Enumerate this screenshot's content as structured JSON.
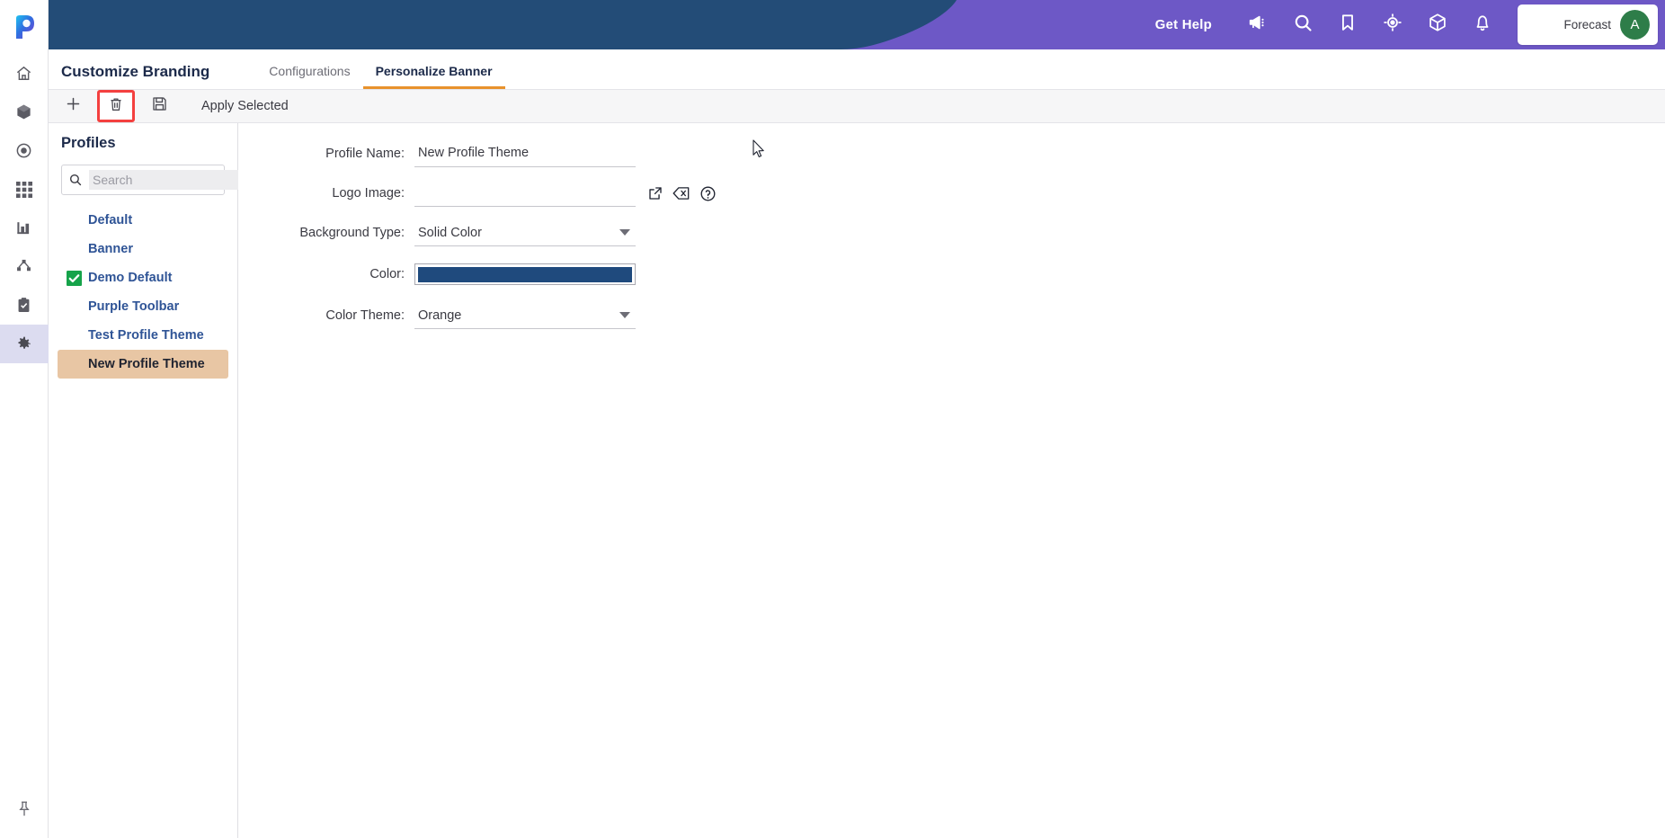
{
  "app": {
    "logo_icon": "pegasystems-p-logo",
    "navy": "#234C77",
    "purple": "#6D58C6",
    "accent_orange": "#E8922C",
    "highlight_red": "#F4403F"
  },
  "rail": {
    "items": [
      {
        "name": "home",
        "icon": "home-icon",
        "active": false
      },
      {
        "name": "packages",
        "icon": "box-icon",
        "active": false
      },
      {
        "name": "targets",
        "icon": "target-icon",
        "active": false
      },
      {
        "name": "apps",
        "icon": "grid-icon",
        "active": false
      },
      {
        "name": "reports",
        "icon": "bar-chart-icon",
        "active": false
      },
      {
        "name": "hierarchy",
        "icon": "hierarchy-icon",
        "active": false
      },
      {
        "name": "tasks",
        "icon": "clipboard-check-icon",
        "active": false
      },
      {
        "name": "settings",
        "icon": "gear-icon",
        "active": true
      }
    ],
    "pin_icon": "pushpin-icon"
  },
  "header": {
    "get_help_label": "Get Help",
    "icons": [
      {
        "name": "announcements",
        "icon": "megaphone-icon"
      },
      {
        "name": "search",
        "icon": "search-icon"
      },
      {
        "name": "bookmarks",
        "icon": "bookmark-icon"
      },
      {
        "name": "focus",
        "icon": "crosshair-icon"
      },
      {
        "name": "packages",
        "icon": "cube-icon"
      },
      {
        "name": "notifications",
        "icon": "bell-icon"
      }
    ],
    "user": {
      "name": "Forecast",
      "avatar_initial": "A",
      "avatar_color": "#2E7D49"
    }
  },
  "titlebar": {
    "page_title": "Customize Branding",
    "tabs": [
      {
        "label": "Configurations",
        "active": false
      },
      {
        "label": "Personalize Banner",
        "active": true
      }
    ]
  },
  "toolbar": {
    "buttons": [
      {
        "name": "add-profile",
        "icon": "plus-icon",
        "highlighted": false
      },
      {
        "name": "delete-profile",
        "icon": "trash-icon",
        "highlighted": true
      },
      {
        "name": "save-profile",
        "icon": "save-icon",
        "highlighted": false
      }
    ],
    "apply_selected_label": "Apply Selected"
  },
  "profiles_panel": {
    "title": "Profiles",
    "search": {
      "value": "",
      "placeholder": "Search",
      "icon": "search-icon"
    },
    "items": [
      {
        "label": "Default",
        "checked": false,
        "selected": false
      },
      {
        "label": "Banner",
        "checked": false,
        "selected": false
      },
      {
        "label": "Demo Default",
        "checked": true,
        "selected": false
      },
      {
        "label": "Purple Toolbar",
        "checked": false,
        "selected": false
      },
      {
        "label": "Test Profile Theme",
        "checked": false,
        "selected": false
      },
      {
        "label": "New Profile Theme",
        "checked": false,
        "selected": true
      }
    ],
    "check_color": "#16A34A",
    "selected_bg": "#E8C6A4"
  },
  "form": {
    "profile_name": {
      "label": "Profile Name:",
      "value": "New Profile Theme",
      "placeholder": ""
    },
    "logo_image": {
      "label": "Logo Image:",
      "value": "",
      "placeholder": "",
      "actions": [
        {
          "name": "open-logo",
          "icon": "external-link-icon"
        },
        {
          "name": "clear-logo",
          "icon": "backspace-icon"
        },
        {
          "name": "logo-help",
          "icon": "help-circle-icon"
        }
      ]
    },
    "background_type": {
      "label": "Background Type:",
      "value": "Solid Color"
    },
    "color": {
      "label": "Color:",
      "value": "#1F4A7D"
    },
    "color_theme": {
      "label": "Color Theme:",
      "value": "Orange"
    }
  }
}
